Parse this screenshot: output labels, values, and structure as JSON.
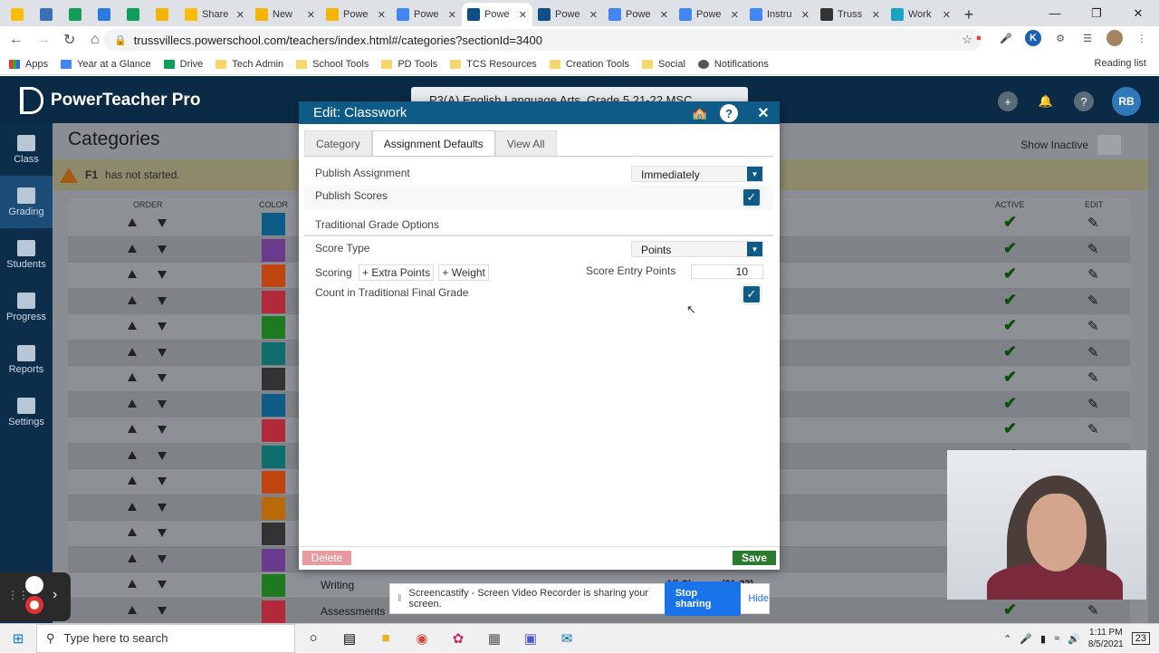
{
  "browser": {
    "tabs": [
      {
        "label": "",
        "icon": "drive-icon",
        "color": "#fbbc05"
      },
      {
        "label": "",
        "icon": "my-icon",
        "color": "#3b6fb6"
      },
      {
        "label": "",
        "icon": "sheets-icon",
        "color": "#0f9d58"
      },
      {
        "label": "",
        "icon": "s-icon",
        "color": "#2a7ae2"
      },
      {
        "label": "",
        "icon": "sheets-icon",
        "color": "#0f9d58"
      },
      {
        "label": "",
        "icon": "jamboard-icon",
        "color": "#f4b400"
      },
      {
        "label": "Share",
        "icon": "drive-icon",
        "color": "#fbbc05"
      },
      {
        "label": "New",
        "icon": "slides-icon",
        "color": "#f4b400"
      },
      {
        "label": "Powe",
        "icon": "slides-icon",
        "color": "#f4b400"
      },
      {
        "label": "Powe",
        "icon": "docs-icon",
        "color": "#4285f4"
      },
      {
        "label": "Powe",
        "icon": "sis-icon",
        "color": "#0d4f86",
        "active": true
      },
      {
        "label": "Powe",
        "icon": "sis-icon",
        "color": "#0d4f86"
      },
      {
        "label": "Powe",
        "icon": "docs-icon",
        "color": "#4285f4"
      },
      {
        "label": "Powe",
        "icon": "docs-icon",
        "color": "#4285f4"
      },
      {
        "label": "Instru",
        "icon": "docs-icon",
        "color": "#4285f4"
      },
      {
        "label": "Truss",
        "icon": "sd-icon",
        "color": "#333333"
      },
      {
        "label": "Work",
        "icon": "diamond-icon",
        "color": "#1aa3c7"
      }
    ],
    "url": "trussvillecs.powerschool.com/teachers/index.html#/categories?sectionId=3400",
    "bookmarks": [
      "Apps",
      "Year at a Glance",
      "Drive",
      "Tech Admin",
      "School Tools",
      "PD Tools",
      "TCS Resources",
      "Creation Tools",
      "Social",
      "Notifications"
    ],
    "reading_list": "Reading list",
    "profile_initial": "K"
  },
  "app": {
    "title": "PowerTeacher Pro",
    "class_selector": "P3(A) English Language Arts, Grade 5   21-22   MSC",
    "avatar": "RB",
    "nav": [
      {
        "label": "Class",
        "icon": "class-icon"
      },
      {
        "label": "Grading",
        "icon": "grading-icon",
        "active": true
      },
      {
        "label": "Students",
        "icon": "students-icon"
      },
      {
        "label": "Progress",
        "icon": "progress-icon"
      },
      {
        "label": "Reports",
        "icon": "reports-icon"
      },
      {
        "label": "Settings",
        "icon": "settings-icon"
      }
    ],
    "page_title": "Categories",
    "show_inactive": "Show Inactive",
    "warning": {
      "bold": "F1",
      "text": "has not started."
    },
    "columns": {
      "order": "ORDER",
      "color": "COLOR",
      "active": "ACTIVE",
      "edit": "EDIT"
    },
    "row_colors": [
      "#0d5b86",
      "#6b3a8c",
      "#c0440f",
      "#b22a3a",
      "#1e7a1e",
      "#0e6e6e",
      "#333333",
      "#0d5b86",
      "#b22a3a",
      "#0e6e6e",
      "#c0440f",
      "#b86a0a",
      "#333333",
      "#6b3a8c",
      "#1e7a1e",
      "#b22a3a"
    ],
    "rows": [
      {
        "name": "",
        "classes": ""
      },
      {
        "name": "",
        "classes": ""
      },
      {
        "name": "",
        "classes": ""
      },
      {
        "name": "",
        "classes": ""
      },
      {
        "name": "",
        "classes": ""
      },
      {
        "name": "",
        "classes": ""
      },
      {
        "name": "",
        "classes": ""
      },
      {
        "name": "",
        "classes": ""
      },
      {
        "name": "",
        "classes": ""
      },
      {
        "name": "",
        "classes": ""
      },
      {
        "name": "",
        "classes": ""
      },
      {
        "name": "",
        "classes": ""
      },
      {
        "name": "",
        "classes": ""
      },
      {
        "name": "",
        "classes": ""
      },
      {
        "name": "Writing",
        "classes": "All Classes (21-22)"
      },
      {
        "name": "Assessments",
        "classes": ""
      }
    ]
  },
  "modal": {
    "title": "Edit: Classwork",
    "tabs": [
      "Category",
      "Assignment Defaults",
      "View All"
    ],
    "active_tab": "Assignment Defaults",
    "publish_assignment_label": "Publish Assignment",
    "publish_assignment_value": "Immediately",
    "publish_scores_label": "Publish Scores",
    "publish_scores_checked": true,
    "section_title": "Traditional Grade Options",
    "score_type_label": "Score Type",
    "score_type_value": "Points",
    "scoring_label": "Scoring",
    "extra_points": "+ Extra Points",
    "weight": "+ Weight",
    "score_entry_label": "Score Entry Points",
    "score_entry_value": "10",
    "count_label": "Count in Traditional Final Grade",
    "count_checked": true,
    "delete_label": "Delete",
    "save_label": "Save"
  },
  "screencastify": {
    "message": "Screencastify - Screen Video Recorder is sharing your screen.",
    "stop_label": "Stop sharing",
    "hide_label": "Hide"
  },
  "taskbar": {
    "search_placeholder": "Type here to search",
    "time": "1:11 PM",
    "date": "8/5/2021",
    "notifications": "23"
  }
}
